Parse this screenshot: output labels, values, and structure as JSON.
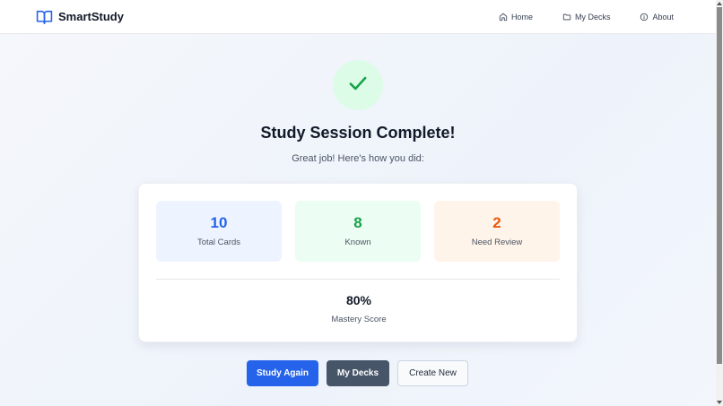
{
  "brand": {
    "name": "SmartStudy",
    "icon": "open-book-icon",
    "color": "#2563eb"
  },
  "nav": {
    "items": [
      {
        "label": "Home",
        "icon": "home-icon"
      },
      {
        "label": "My Decks",
        "icon": "folder-icon"
      },
      {
        "label": "About",
        "icon": "info-icon"
      }
    ]
  },
  "result": {
    "icon": "checkmark-icon",
    "title": "Study Session Complete!",
    "subtitle": "Great job! Here's how you did:"
  },
  "stats": {
    "total": {
      "value": "10",
      "label": "Total Cards",
      "color": "#2563eb"
    },
    "known": {
      "value": "8",
      "label": "Known",
      "color": "#16a34a"
    },
    "review": {
      "value": "2",
      "label": "Need Review",
      "color": "#ea580c"
    }
  },
  "mastery": {
    "value": "80%",
    "label": "Mastery Score"
  },
  "actions": {
    "study_again": "Study Again",
    "my_decks": "My Decks",
    "create_new": "Create New"
  }
}
